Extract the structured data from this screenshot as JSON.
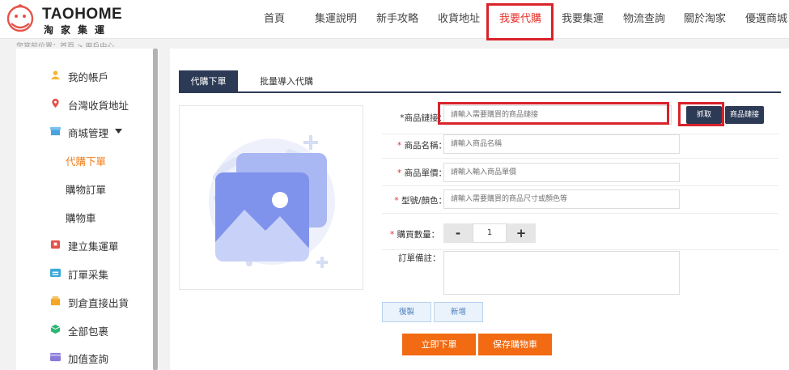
{
  "brand": {
    "name_en": "TAOHOME",
    "name_zh": "淘家集運"
  },
  "nav": {
    "items": [
      "首頁",
      "集運說明",
      "新手攻略",
      "收貨地址",
      "我要代購",
      "我要集運",
      "物流查詢",
      "關於淘家",
      "優選商城"
    ],
    "active_index": 4
  },
  "breadcrumb": "您當前位置：首頁 > 用戶中心",
  "sidebar": {
    "items": [
      {
        "label": "我的帳戶",
        "icon": "user-icon",
        "color": "#f5b731"
      },
      {
        "label": "台灣收貨地址",
        "icon": "location-pin-icon",
        "color": "#e4544a"
      },
      {
        "label": "商城管理",
        "icon": "store-icon",
        "color": "#4aa3df"
      },
      {
        "label": "建立集運單",
        "icon": "package-create-icon",
        "color": "#e4544a"
      },
      {
        "label": "訂單采集",
        "icon": "order-collect-icon",
        "color": "#3aa9d9"
      },
      {
        "label": "到倉直接出貨",
        "icon": "warehouse-ship-icon",
        "color": "#f5a623"
      },
      {
        "label": "全部包裹",
        "icon": "box-icon",
        "color": "#2bb673"
      },
      {
        "label": "加值查詢",
        "icon": "value-added-icon",
        "color": "#8a7ad8"
      }
    ],
    "submenu": [
      "代購下單",
      "購物訂單",
      "購物車"
    ],
    "submenu_active_index": 0
  },
  "tabs": [
    "代購下單",
    "批量導入代購"
  ],
  "form": {
    "url": {
      "label": "*商品鏈接：",
      "placeholder": "請輸入需要購買的商品鏈接"
    },
    "fetch_button": "抓取",
    "link_button": "商品鏈接",
    "name": {
      "label": "商品名稱：",
      "placeholder": "請輸入商品名稱"
    },
    "price": {
      "label": "商品單價：",
      "placeholder": "請輸入輸入商品單價"
    },
    "variant": {
      "label": "型號/顏色：",
      "placeholder": "請輸入需要購買的商品尺寸或顏色等"
    },
    "quantity": {
      "label": "購買數量：",
      "value": "1",
      "minus": "-",
      "plus": "+"
    },
    "note": {
      "label": "訂單備註："
    },
    "copy_button": "復製",
    "add_button": "新增",
    "order_button": "立即下單",
    "cart_button": "保存購物車"
  },
  "colors": {
    "accent": "#f26a11",
    "navy": "#2c3a55",
    "highlight": "#d9232a",
    "active_text": "#e4322b"
  }
}
